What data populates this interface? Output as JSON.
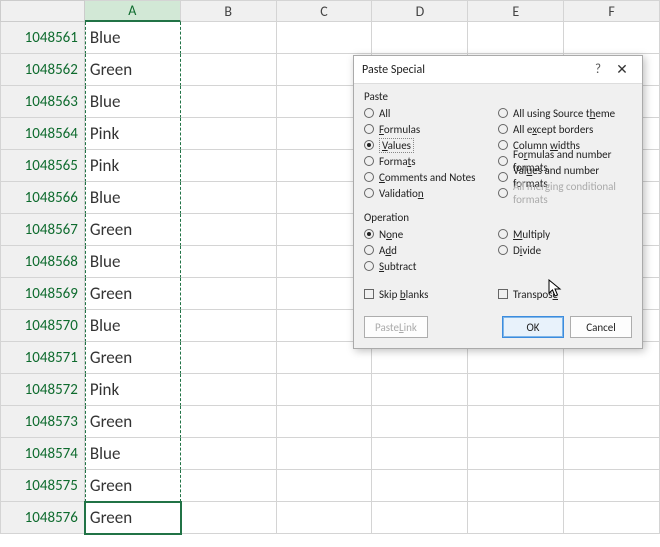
{
  "columns": [
    "A",
    "B",
    "C",
    "D",
    "E",
    "F"
  ],
  "selected_col": "A",
  "active_row_index": 15,
  "rows": [
    {
      "num": "1048561",
      "a": "Blue"
    },
    {
      "num": "1048562",
      "a": "Green"
    },
    {
      "num": "1048563",
      "a": "Blue"
    },
    {
      "num": "1048564",
      "a": "Pink"
    },
    {
      "num": "1048565",
      "a": "Pink"
    },
    {
      "num": "1048566",
      "a": "Blue"
    },
    {
      "num": "1048567",
      "a": "Green"
    },
    {
      "num": "1048568",
      "a": "Blue"
    },
    {
      "num": "1048569",
      "a": "Green"
    },
    {
      "num": "1048570",
      "a": "Blue"
    },
    {
      "num": "1048571",
      "a": "Green"
    },
    {
      "num": "1048572",
      "a": "Pink"
    },
    {
      "num": "1048573",
      "a": "Green"
    },
    {
      "num": "1048574",
      "a": "Blue"
    },
    {
      "num": "1048575",
      "a": "Green"
    },
    {
      "num": "1048576",
      "a": "Green"
    }
  ],
  "dialog": {
    "title": "Paste Special",
    "help": "?",
    "close": "✕",
    "group_paste": "Paste",
    "group_operation": "Operation",
    "paste_left": [
      {
        "key": "all",
        "pre": "A",
        "mid": "",
        "post": "ll",
        "checked": false
      },
      {
        "key": "formulas",
        "pre": "",
        "mid": "F",
        "post": "ormulas",
        "checked": false
      },
      {
        "key": "values",
        "pre": "",
        "mid": "V",
        "post": "alues",
        "checked": true
      },
      {
        "key": "formats",
        "pre": "Forma",
        "mid": "t",
        "post": "s",
        "checked": false
      },
      {
        "key": "comments",
        "pre": "",
        "mid": "C",
        "post": "omments and Notes",
        "checked": false
      },
      {
        "key": "validation",
        "pre": "Validatio",
        "mid": "n",
        "post": "",
        "checked": false
      }
    ],
    "paste_right": [
      {
        "key": "source-theme",
        "pre": "All using Source t",
        "mid": "h",
        "post": "eme",
        "checked": false,
        "disabled": false
      },
      {
        "key": "except-borders",
        "pre": "All e",
        "mid": "x",
        "post": "cept borders",
        "checked": false,
        "disabled": false
      },
      {
        "key": "col-widths",
        "pre": "Column ",
        "mid": "w",
        "post": "idths",
        "checked": false,
        "disabled": false
      },
      {
        "key": "formulas-num-fmt",
        "pre": "Fo",
        "mid": "r",
        "post": "mulas and number formats",
        "checked": false,
        "disabled": false
      },
      {
        "key": "values-num-fmt",
        "pre": "Val",
        "mid": "u",
        "post": "es and number formats",
        "checked": false,
        "disabled": false
      },
      {
        "key": "merging-cond-fmt",
        "pre": "All mer",
        "mid": "g",
        "post": "ing conditional formats",
        "checked": false,
        "disabled": true
      }
    ],
    "op_left": [
      {
        "key": "none",
        "pre": "N",
        "mid": "o",
        "post": "ne",
        "checked": true
      },
      {
        "key": "add",
        "pre": "A",
        "mid": "d",
        "post": "d",
        "checked": false
      },
      {
        "key": "subtract",
        "pre": "",
        "mid": "S",
        "post": "ubtract",
        "checked": false
      }
    ],
    "op_right": [
      {
        "key": "multiply",
        "pre": "",
        "mid": "M",
        "post": "ultiply",
        "checked": false
      },
      {
        "key": "divide",
        "pre": "D",
        "mid": "i",
        "post": "vide",
        "checked": false
      }
    ],
    "skip_blanks": {
      "pre": "Skip ",
      "mid": "b",
      "post": "lanks",
      "checked": false
    },
    "transpose": {
      "pre": "Transpos",
      "mid": "e",
      "post": "",
      "checked": false
    },
    "paste_link": {
      "pre": "Paste ",
      "mid": "L",
      "post": "ink"
    },
    "ok": "OK",
    "cancel": "Cancel"
  }
}
